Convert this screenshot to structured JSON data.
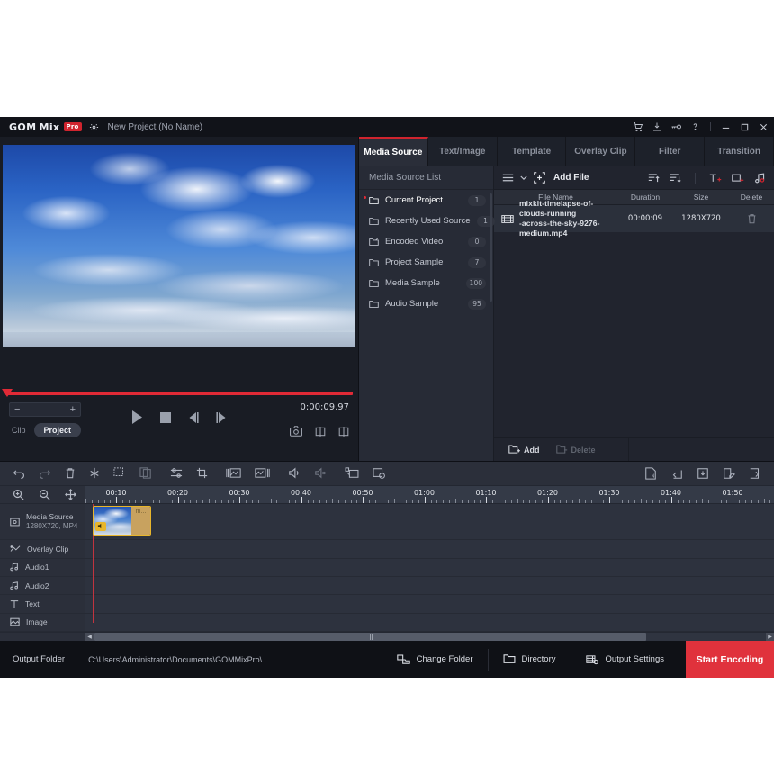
{
  "titlebar": {
    "logo_gom": "GOM",
    "logo_mix": "Mix",
    "badge": "Pro",
    "gear_icon": "gear-icon",
    "project_name": "New Project (No Name)",
    "icons": [
      "cart-icon",
      "download-icon",
      "key-icon",
      "help-icon"
    ],
    "window": {
      "minimize": "minimize-icon",
      "maximize": "maximize-icon",
      "close": "close-icon"
    }
  },
  "preview": {
    "time": "0:00:09.97",
    "zoom_minus": "−",
    "zoom_plus": "+",
    "clip_label": "Clip",
    "project_label": "Project",
    "transport": [
      "play-icon",
      "stop-icon",
      "prev-frame-icon",
      "next-frame-icon"
    ],
    "right_icons": [
      "snapshot-icon",
      "flip-horizontal-icon",
      "flip-vertical-icon"
    ]
  },
  "tabs": [
    {
      "label": "Media Source",
      "active": true
    },
    {
      "label": "Text/Image",
      "active": false
    },
    {
      "label": "Template",
      "active": false
    },
    {
      "label": "Overlay Clip",
      "active": false
    },
    {
      "label": "Filter",
      "active": false
    },
    {
      "label": "Transition",
      "active": false
    }
  ],
  "source_list": {
    "header": "Media Source List",
    "items": [
      {
        "label": "Current Project",
        "count": "1",
        "icon": "folder-open-icon",
        "selected": true
      },
      {
        "label": "Recently Used Source",
        "count": "1",
        "icon": "folder-icon",
        "selected": false
      },
      {
        "label": "Encoded Video",
        "count": "0",
        "icon": "folder-encoded-icon",
        "selected": false
      },
      {
        "label": "Project Sample",
        "count": "7",
        "icon": "folder-icon",
        "selected": false
      },
      {
        "label": "Media Sample",
        "count": "100",
        "icon": "folder-icon",
        "selected": false
      },
      {
        "label": "Audio Sample",
        "count": "95",
        "icon": "folder-icon",
        "selected": false
      }
    ]
  },
  "file_toolbar": {
    "menu_icon": "list-menu-icon",
    "chevron_icon": "chevron-down-icon",
    "add_file_icon": "add-file-icon",
    "add_file_label": "Add File",
    "sort_asc_icon": "sort-ascending-icon",
    "sort_desc_icon": "sort-descending-icon",
    "add_text_icon": "add-text-track-icon",
    "add_image_icon": "add-image-track-icon",
    "add_audio_icon": "add-audio-track-icon"
  },
  "file_table": {
    "columns": [
      "File Name",
      "Duration",
      "Size",
      "Delete"
    ],
    "rows": [
      {
        "icon": "video-file-icon",
        "name_line1": "mixkit-timelapse-of-clouds-running",
        "name_line2": "-across-the-sky-9276-medium.mp4",
        "duration": "00:00:09",
        "size": "1280X720",
        "delete_icon": "trash-icon"
      }
    ]
  },
  "file_footer": {
    "add_label": "Add",
    "add_icon": "folder-add-icon",
    "delete_label": "Delete",
    "delete_icon": "folder-remove-icon"
  },
  "timeline_toolbar": {
    "left_icons": [
      "undo-icon",
      "redo-icon",
      "delete-icon",
      "split-icon",
      "select-region-icon",
      "duplicate-icon"
    ],
    "mid_icons": [
      "adjust-icon",
      "crop-icon"
    ],
    "frame_icons": [
      "fade-in-icon",
      "fade-out-icon"
    ],
    "audio_icons": [
      "volume-icon",
      "mute-icon"
    ],
    "capture_icons": [
      "capture-screen-icon",
      "capture-timer-icon"
    ],
    "right_icons": [
      "new-project-icon",
      "open-project-icon",
      "save-project-icon",
      "edit-project-icon",
      "export-project-icon"
    ]
  },
  "timeline": {
    "zoom_in_icon": "zoom-in-icon",
    "zoom_out_icon": "zoom-out-icon",
    "fit_icon": "fit-move-icon",
    "ruler_labels": [
      "00:10",
      "00:20",
      "00:30",
      "00:40",
      "00:50",
      "01:00",
      "01:10",
      "01:20",
      "01:30",
      "01:40",
      "01:50"
    ],
    "tracks": [
      {
        "name": "Media Source",
        "sub": "1280X720, MP4",
        "icon": "media-source-icon"
      },
      {
        "name": "Overlay Clip",
        "sub": "",
        "icon": "overlay-clip-icon"
      },
      {
        "name": "Audio1",
        "sub": "",
        "icon": "audio-icon"
      },
      {
        "name": "Audio2",
        "sub": "",
        "icon": "audio-icon"
      },
      {
        "name": "Text",
        "sub": "",
        "icon": "text-icon"
      },
      {
        "name": "Image",
        "sub": "",
        "icon": "image-icon"
      }
    ],
    "clip_label": "m...",
    "clip_speaker_icon": "speaker-icon",
    "scroll_left_icon": "scroll-left-icon",
    "scroll_right_icon": "scroll-right-icon"
  },
  "footer": {
    "output_folder_label": "Output Folder",
    "output_folder_path": "C:\\Users\\Administrator\\Documents\\GOMMixPro\\",
    "change_folder_label": "Change Folder",
    "change_folder_icon": "change-folder-icon",
    "directory_label": "Directory",
    "directory_icon": "folder-icon",
    "output_settings_label": "Output Settings",
    "output_settings_icon": "output-settings-icon",
    "start_encoding_label": "Start Encoding"
  },
  "colors": {
    "accent_red": "#e0323c",
    "clip_border": "#e8b62c",
    "panel_bg": "#21242e"
  }
}
